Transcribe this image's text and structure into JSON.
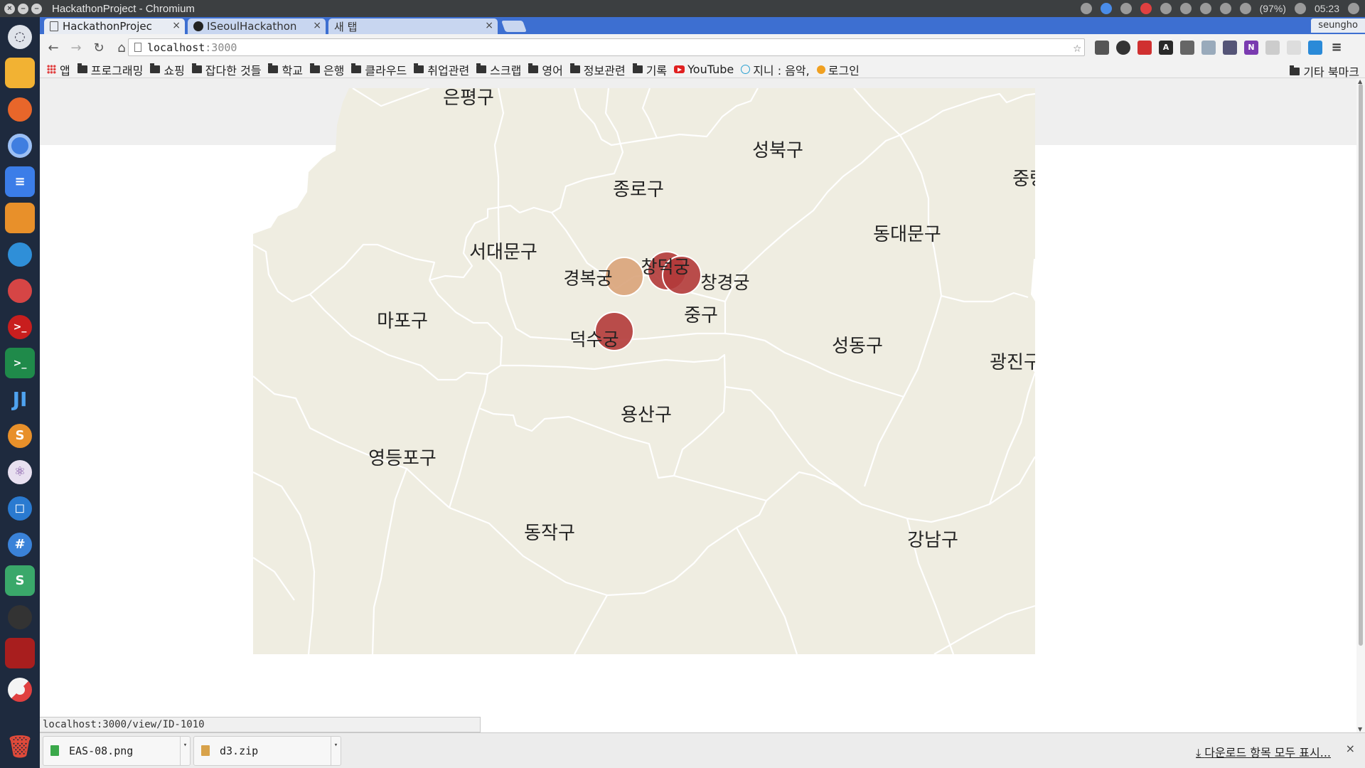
{
  "os": {
    "window_title": "HackathonProject - Chromium",
    "battery": "(97%)",
    "clock": "05:23",
    "user": "seungho"
  },
  "browser": {
    "tabs": [
      {
        "label": "HackathonProjec",
        "active": true
      },
      {
        "label": "ISeoulHackathon",
        "active": false
      },
      {
        "label": "새 탭",
        "active": false
      }
    ],
    "url_host": "localhost",
    "url_port": ":3000",
    "bookmarks": [
      "앱",
      "프로그래밍",
      "쇼핑",
      "잡다한 것들",
      "학교",
      "은행",
      "클라우드",
      "취업관련",
      "스크랩",
      "영어",
      "정보관련",
      "기록",
      "YouTube",
      "지니 : 음악,",
      "로그인"
    ],
    "bookmarks_other": "기타 북마크",
    "status_url": "localhost:3000/view/ID-1010"
  },
  "downloads": {
    "items": [
      "EAS-08.png",
      "d3.zip"
    ],
    "show_all": "다운로드 항목 모두 표시..."
  },
  "map": {
    "districts": [
      "은평구",
      "성북구",
      "중랑구",
      "종로구",
      "동대문구",
      "서대문구",
      "마포구",
      "중구",
      "성동구",
      "광진구",
      "용산구",
      "영등포구",
      "동작구",
      "강남구"
    ],
    "palaces": [
      {
        "name": "경복궁",
        "color": "#d9a37a"
      },
      {
        "name": "창덕궁",
        "color": "#b23a3a"
      },
      {
        "name": "창경궁",
        "color": "#b23a3a"
      },
      {
        "name": "덕수궁",
        "color": "#b23a3a"
      }
    ],
    "land_color": "#efede1",
    "border_color": "#ffffff"
  }
}
